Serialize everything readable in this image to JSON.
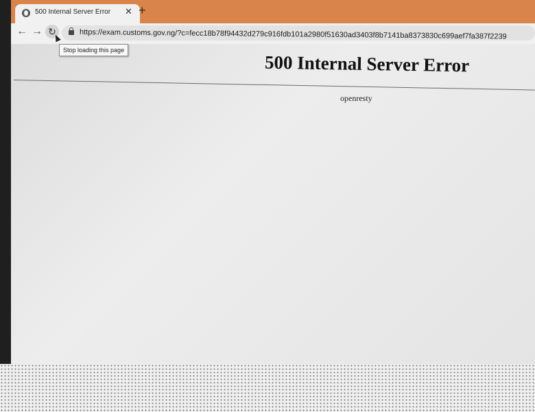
{
  "browser": {
    "tab": {
      "title": "500 Internal Server Error",
      "close_icon": "close-icon",
      "favicon_icon": "globe-icon"
    },
    "new_tab_label": "+",
    "toolbar": {
      "back_icon": "back-arrow-icon",
      "forward_icon": "forward-arrow-icon",
      "reload_icon": "reload-icon",
      "url": "https://exam.customs.gov.ng/?c=fecc18b78f94432d279c916fdb101a2980f51630ad3403f8b7141ba8373830c699aef7fa387f2239"
    },
    "tooltip": "Stop loading this page",
    "colors": {
      "tab_strip": "#d9844a",
      "toolbar": "#f1f1f1"
    }
  },
  "page": {
    "heading": "500 Internal Server Error",
    "server": "openresty"
  }
}
